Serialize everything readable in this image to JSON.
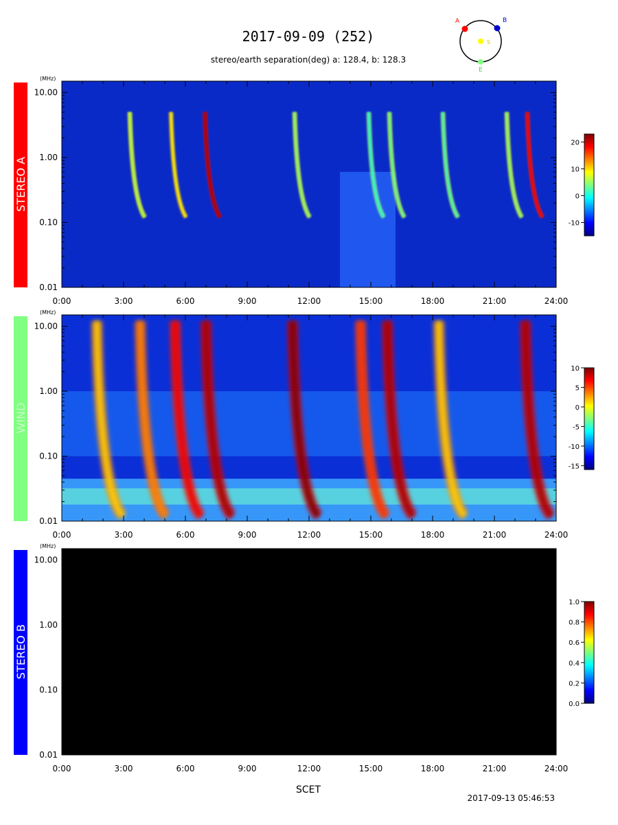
{
  "header": {
    "title": "2017-09-09 (252)",
    "subtitle": "stereo/earth separation(deg) a: 128.4, b: 128.3",
    "orbit": {
      "labels": {
        "a": "A",
        "b": "B",
        "s": "S",
        "e": "E"
      }
    }
  },
  "footer": {
    "xlabel": "SCET",
    "timestamp": "2017-09-13 05:46:53"
  },
  "colors": {
    "stereo_a": "#ff0000",
    "wind": "#80ff80",
    "stereo_b": "#0000ff",
    "orbit_a": "#ff0000",
    "orbit_b": "#0000cc",
    "orbit_s": "#ffff00",
    "orbit_e": "#80ff80"
  },
  "chart_data": [
    {
      "type": "heatmap",
      "panel_label": "STEREO A",
      "unit": "(MHz)",
      "y_scale": "log",
      "ylim": [
        0.01,
        15
      ],
      "yticks": [
        "10.00",
        "1.00",
        "0.10",
        "0.01"
      ],
      "ytick_values": [
        10,
        1,
        0.1,
        0.01
      ],
      "xlim_hours": [
        0,
        24
      ],
      "xticks": [
        "0:00",
        "3:00",
        "6:00",
        "9:00",
        "12:00",
        "15:00",
        "18:00",
        "21:00",
        "24:00"
      ],
      "colorbar": {
        "ticks": [
          "20",
          "10",
          "0",
          "-10"
        ],
        "tick_values": [
          20,
          10,
          0,
          -10
        ],
        "range": [
          -15,
          23
        ]
      },
      "bursts": [
        {
          "t": 3.3,
          "intensity": 0.55
        },
        {
          "t": 5.3,
          "intensity": 0.65
        },
        {
          "t": 6.95,
          "intensity": 0.95
        },
        {
          "t": 11.3,
          "intensity": 0.5
        },
        {
          "t": 14.9,
          "intensity": 0.35
        },
        {
          "t": 15.9,
          "intensity": 0.45
        },
        {
          "t": 18.5,
          "intensity": 0.4
        },
        {
          "t": 21.6,
          "intensity": 0.5
        },
        {
          "t": 22.6,
          "intensity": 0.85
        }
      ]
    },
    {
      "type": "heatmap",
      "panel_label": "WIND",
      "unit": "(MHz)",
      "y_scale": "log",
      "ylim": [
        0.01,
        15
      ],
      "yticks": [
        "10.00",
        "1.00",
        "0.10",
        "0.01"
      ],
      "ytick_values": [
        10,
        1,
        0.1,
        0.01
      ],
      "xlim_hours": [
        0,
        24
      ],
      "xticks": [
        "0:00",
        "3:00",
        "6:00",
        "9:00",
        "12:00",
        "15:00",
        "18:00",
        "21:00",
        "24:00"
      ],
      "colorbar": {
        "ticks": [
          "10",
          "5",
          "0",
          "-5",
          "-10",
          "-15"
        ],
        "tick_values": [
          10,
          5,
          0,
          -5,
          -10,
          -15
        ],
        "range": [
          -16,
          10
        ]
      },
      "bursts": [
        {
          "t": 1.7,
          "intensity": 0.7
        },
        {
          "t": 3.8,
          "intensity": 0.75
        },
        {
          "t": 5.5,
          "intensity": 0.85
        },
        {
          "t": 7.0,
          "intensity": 0.95
        },
        {
          "t": 11.2,
          "intensity": 1.0
        },
        {
          "t": 14.5,
          "intensity": 0.8
        },
        {
          "t": 15.8,
          "intensity": 0.95
        },
        {
          "t": 18.3,
          "intensity": 0.7
        },
        {
          "t": 22.5,
          "intensity": 0.95
        }
      ]
    },
    {
      "type": "heatmap",
      "panel_label": "STEREO B",
      "unit": "(MHz)",
      "y_scale": "log",
      "ylim": [
        0.01,
        15
      ],
      "yticks": [
        "10.00",
        "1.00",
        "0.10",
        "0.01"
      ],
      "ytick_values": [
        10,
        1,
        0.1,
        0.01
      ],
      "xlim_hours": [
        0,
        24
      ],
      "xticks": [
        "0:00",
        "3:00",
        "6:00",
        "9:00",
        "12:00",
        "15:00",
        "18:00",
        "21:00",
        "24:00"
      ],
      "colorbar": {
        "ticks": [
          "1.0",
          "0.8",
          "0.6",
          "0.4",
          "0.2",
          "0.0"
        ],
        "tick_values": [
          1.0,
          0.8,
          0.6,
          0.4,
          0.2,
          0.0
        ],
        "range": [
          0,
          1
        ]
      },
      "no_data": true,
      "bursts": []
    }
  ]
}
